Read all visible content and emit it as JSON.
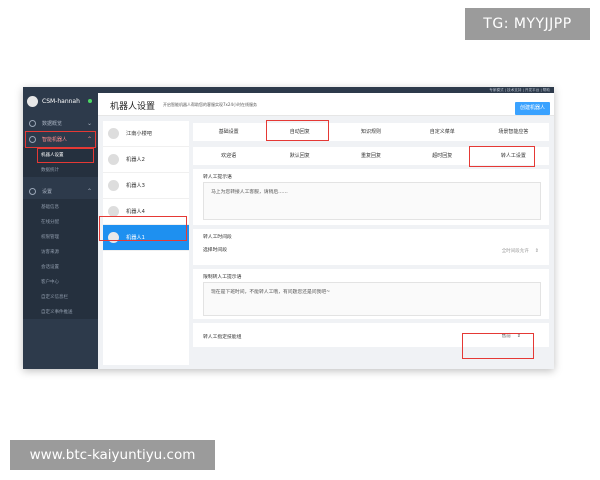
{
  "watermarks": {
    "top": "TG: MYYJJPP",
    "bottom": "www.btc-kaiyuntiyu.com"
  },
  "user": {
    "name": "CSM-hannah"
  },
  "sidebar": {
    "items": [
      {
        "label": "数据概览"
      },
      {
        "label": "智能机器人"
      },
      {
        "label": "机器人设置"
      },
      {
        "label": "数据统计"
      },
      {
        "label": "设置"
      },
      {
        "label": "基础信息"
      },
      {
        "label": "在线分配"
      },
      {
        "label": "权限管理"
      },
      {
        "label": "访客来源"
      },
      {
        "label": "会话设置"
      },
      {
        "label": "客户中心"
      },
      {
        "label": "自定义信息栏"
      },
      {
        "label": "自定义事件推送"
      }
    ]
  },
  "header": {
    "top_links": "专家模式 | 技术支持 | 开发平台 | 帮助",
    "title": "机器人设置",
    "subtitle": "开启智能机器人帮助您的客服实现7x24小时在线服务",
    "create_button": "创建机器人"
  },
  "robots": [
    {
      "name": "江南小楼吧"
    },
    {
      "name": "机器人2"
    },
    {
      "name": "机器人3"
    },
    {
      "name": "机器人4"
    },
    {
      "name": "机器人1"
    }
  ],
  "tabs_primary": [
    {
      "label": "基础设置"
    },
    {
      "label": "自动回复"
    },
    {
      "label": "知识规则"
    },
    {
      "label": "自定义菜单"
    },
    {
      "label": "场景智能应答"
    }
  ],
  "tabs_secondary": [
    {
      "label": "欢迎语"
    },
    {
      "label": "默认回复"
    },
    {
      "label": "重复回复"
    },
    {
      "label": "超时回复"
    },
    {
      "label": "转人工设置"
    }
  ],
  "sections": {
    "transfer_prompt_label": "转人工提示语",
    "transfer_prompt_text": "马上为您转接人工客服，请稍后……",
    "transfer_time_label": "转人工时间段",
    "select_time_label": "选择时间段",
    "select_time_value": "全时间段允许",
    "deny_prompt_label": "限制转人工提示语",
    "deny_prompt_text": "现在是下班时间，不能转人工哦，有问题您还是问我吧~",
    "designated_group_label": "转人工指定技能组",
    "designated_group_value": "售前"
  },
  "colors": {
    "sidebar_bg": "#2d3a4b",
    "accent_blue": "#1e90f0",
    "highlight_red": "#e53935"
  }
}
